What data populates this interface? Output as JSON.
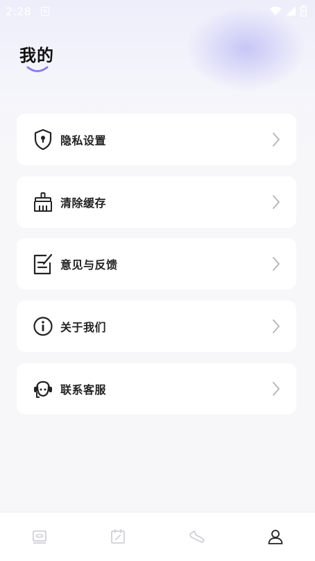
{
  "status_bar": {
    "time": "2:28",
    "notification_glyph": "A",
    "icons": [
      "wifi-icon",
      "signal-icon",
      "battery-icon"
    ]
  },
  "page": {
    "title": "我的"
  },
  "menu": {
    "items": [
      {
        "id": "privacy",
        "label": "隐私设置",
        "icon": "shield-lock-icon"
      },
      {
        "id": "cache",
        "label": "清除缓存",
        "icon": "broom-icon"
      },
      {
        "id": "feedback",
        "label": "意见与反馈",
        "icon": "note-edit-icon"
      },
      {
        "id": "about",
        "label": "关于我们",
        "icon": "info-icon"
      },
      {
        "id": "service",
        "label": "联系客服",
        "icon": "headset-icon"
      }
    ]
  },
  "bottom_nav": {
    "tabs": [
      {
        "id": "home",
        "icon": "book-icon",
        "active": false
      },
      {
        "id": "checkin",
        "icon": "calendar-edit-icon",
        "active": false
      },
      {
        "id": "sport",
        "icon": "sneaker-icon",
        "active": false
      },
      {
        "id": "mine",
        "icon": "person-icon",
        "active": true
      }
    ]
  },
  "colors": {
    "accent": "#8b7be8",
    "text_primary": "#111111",
    "icon_inactive": "#cfcfd6",
    "icon_active": "#222222",
    "card_bg": "#ffffff",
    "page_bg": "#f7f7fa"
  }
}
